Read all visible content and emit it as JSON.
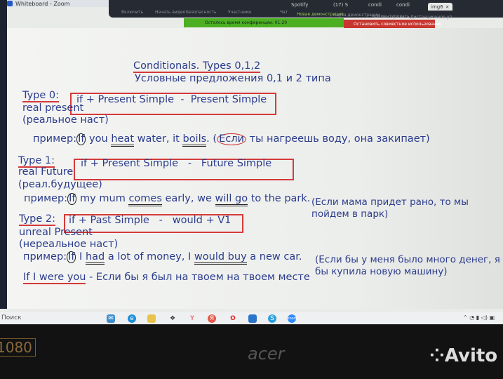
{
  "window": {
    "title": "Whiteboard - Zoom"
  },
  "zoom_toolbar": {
    "items": [
      "Включить",
      "Начать видео",
      "Безопасность",
      "Участники",
      "Чат",
      "Новая демонстрация",
      "Пауза демонстрации",
      "Комментировать",
      "Дистанционное управление"
    ],
    "browser_tabs": [
      "Spotify",
      "(17) S",
      "condi",
      "condi",
      "img6"
    ],
    "banner_time": "Осталось время конференции: 01:20",
    "stop_share": "Остановить совместное использование",
    "colors": {
      "banner": "#4caf21",
      "stop": "#c7362f"
    }
  },
  "board": {
    "title": "Conditionals. Types 0,1,2",
    "subtitle": "Условные предложения 0,1 и 2 типа",
    "type0": {
      "label": "Type 0:",
      "formula": "if + Present Simple  -  Present Simple",
      "name": "real present",
      "name_ru": "(реальное наст)",
      "example_label": "пример:",
      "ex_if": "If",
      "ex_1": " you ",
      "ex_verb1": "heat",
      "ex_2": " water, it ",
      "ex_verb2": "boils",
      "ex_3": ". (",
      "ex_ru_if": "Если",
      "ex_ru": " ты нагреешь воду, она закипает)"
    },
    "type1": {
      "label": "Type 1:",
      "formula": "if + Present Simple   -   Future Simple",
      "name": "real Future",
      "name_ru": "(реал.будущее)",
      "example_label": "пример:",
      "ex_if": "If",
      "ex_1": " my mum ",
      "ex_verb1": "comes",
      "ex_2": " early, we ",
      "ex_verb2": "will go",
      "ex_3": " to the park.",
      "ex_ru_line1": "(Если мама придет рано, то мы",
      "ex_ru_line2": "пойдем в парк)"
    },
    "type2": {
      "label": "Type 2:",
      "formula": "if + Past Simple   -   would + V1",
      "name": "unreal Present",
      "name_ru": "(нереальное наст)",
      "example_label": "пример:",
      "ex_if": "If",
      "ex_1": " I ",
      "ex_verb1": "had",
      "ex_2": " a lot of money, I ",
      "ex_verb2": "would buy",
      "ex_3": " a new car.",
      "ex_ru_line1": "(Если бы у меня было много денег, я",
      "ex_ru_line2": "бы купила новую машину)"
    },
    "phrase": "If I were you",
    "phrase_ru": " - Если бы я был на твоем на твоем месте"
  },
  "taskbar": {
    "search": "Поиск",
    "icons": [
      "mail-icon",
      "edge-icon",
      "explorer-icon",
      "dropbox-icon",
      "yandex-y-icon",
      "yandex-browser-icon",
      "opera-icon",
      "store-icon",
      "skype-icon",
      "zoom-icon"
    ]
  },
  "bezel": {
    "sticker": "1080",
    "brand": "acer",
    "watermark": "Avito"
  }
}
